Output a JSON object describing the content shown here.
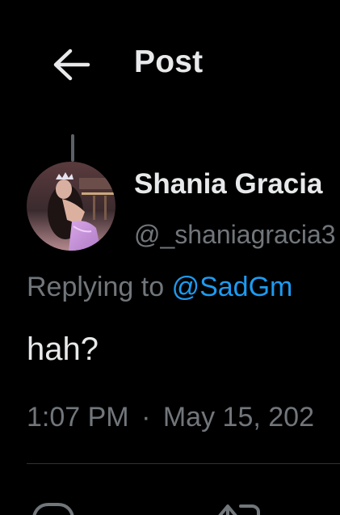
{
  "header": {
    "title": "Post",
    "back_icon": "arrow-left-icon"
  },
  "post": {
    "author": {
      "name": "Shania Gracia",
      "handle": "@_shaniagracia3"
    },
    "reply_prefix": "Replying to",
    "reply_to": "@SadGm",
    "text": "hah?",
    "time": "1:07 PM",
    "separator": "·",
    "date": "May 15, 202"
  },
  "actions": [
    {
      "icon": "reply-icon"
    },
    {
      "icon": "repost-icon"
    }
  ],
  "colors": {
    "background": "#000000",
    "primary_text": "#e7e9ea",
    "secondary_text": "#71767b",
    "link": "#1d9bf0",
    "divider": "#2f3336"
  }
}
